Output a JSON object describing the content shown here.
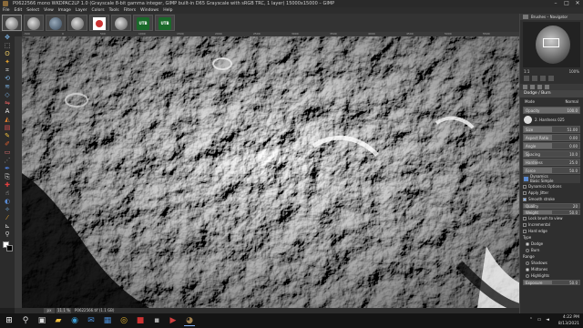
{
  "window": {
    "title": "P0622566 mono WKDPAC2LP 1.0 (Grayscale 8-bit gamma integer, GIMP built-in D65 Grayscale with sRGB TRC, 1 layer) 15000x15000 – GIMP",
    "controls": [
      "–",
      "□",
      "✕"
    ]
  },
  "menu": [
    "File",
    "Edit",
    "Select",
    "View",
    "Image",
    "Layer",
    "Colors",
    "Tools",
    "Filters",
    "Windows",
    "Help"
  ],
  "image_tabs": [
    {
      "icon": "gray-moon-thumb"
    },
    {
      "icon": "gray-moon-thumb"
    },
    {
      "icon": "globe-thumb"
    },
    {
      "icon": "gray-moon-thumb"
    },
    {
      "icon": "red-dot-thumb"
    },
    {
      "icon": "gray-moon-thumb"
    },
    {
      "icon": "utb-thumb",
      "label": "UTB"
    },
    {
      "icon": "utb-thumb",
      "label": "UTB"
    }
  ],
  "toolbox": [
    "move-icon",
    "rect-select-icon",
    "lasso-icon",
    "fuzzy-select-icon",
    "crop-icon",
    "transform-icon",
    "warp-icon",
    "perspective-icon",
    "flip-icon",
    "text-icon",
    "bucket-fill-icon",
    "gradient-icon",
    "pencil-icon",
    "paintbrush-icon",
    "eraser-icon",
    "airbrush-icon",
    "ink-icon",
    "clone-icon",
    "heal-icon",
    "smudge-icon",
    "dodge-icon",
    "path-icon",
    "color-picker-icon",
    "measure-icon",
    "zoom-icon",
    "foreground-color-icon",
    "background-color-icon"
  ],
  "rulers": {
    "h_ticks": [
      "-500",
      "0",
      "500",
      "1000",
      "1500",
      "2000",
      "2500",
      "3000",
      "3500",
      "4000",
      "4500",
      "5000",
      "5500"
    ]
  },
  "statusbar": {
    "unit": "px",
    "zoom": "11.1 %",
    "filename": "P0622566.tif (1.1 GB)"
  },
  "dock": {
    "panel_title": "Brushes – Navigator",
    "zoom_left": "1:1",
    "zoom_right": "100%",
    "tool_title": "Dodge / Burn",
    "options": [
      {
        "label": "Mode",
        "value": "Normal",
        "type": "select"
      },
      {
        "label": "Opacity",
        "value": "100.0",
        "fill": 1.0,
        "type": "bar"
      },
      {
        "label": "Brush",
        "value": "2. Hardness 025",
        "type": "brush"
      },
      {
        "label": "Size",
        "value": "51.00",
        "fill": 0.5,
        "type": "bar"
      },
      {
        "label": "Aspect Ratio",
        "value": "0.00",
        "fill": 0.5,
        "type": "bar"
      },
      {
        "label": "Angle",
        "value": "0.00",
        "fill": 0.5,
        "type": "bar"
      },
      {
        "label": "Spacing",
        "value": "10.0",
        "fill": 0.1,
        "type": "bar"
      },
      {
        "label": "Hardness",
        "value": "25.0",
        "fill": 0.25,
        "type": "bar"
      },
      {
        "label": "Force",
        "value": "50.0",
        "fill": 0.5,
        "type": "bar"
      }
    ],
    "dynamics_label": "Dynamics",
    "dynamics_value": "Basic Simple",
    "checks": [
      {
        "label": "Dynamics Options",
        "on": false
      },
      {
        "label": "Apply Jitter",
        "on": false
      },
      {
        "label": "Smooth stroke",
        "on": true
      }
    ],
    "smooth_opts": [
      {
        "label": "Quality",
        "value": "20",
        "fill": 0.2
      },
      {
        "label": "Weight",
        "value": "50.0",
        "fill": 0.5
      }
    ],
    "more_checks": [
      {
        "label": "Lock brush to view",
        "on": false
      },
      {
        "label": "Incremental",
        "on": false
      },
      {
        "label": "Hard edge",
        "on": false
      }
    ],
    "type_label": "Type",
    "type_options": [
      {
        "label": "Dodge",
        "on": true
      },
      {
        "label": "Burn",
        "on": false
      }
    ],
    "range_label": "Range",
    "range_options": [
      {
        "label": "Shadows",
        "on": false
      },
      {
        "label": "Midtones",
        "on": true
      },
      {
        "label": "Highlights",
        "on": false
      }
    ],
    "exposure_label": "Exposure",
    "exposure_value": "50.0",
    "exposure_fill": 0.5
  },
  "taskbar": {
    "items": [
      "windows-start-icon",
      "search-icon",
      "task-view-icon",
      "file-explorer-icon",
      "edge-icon",
      "mail-icon",
      "store-icon",
      "chrome-icon",
      "app-icon",
      "app-icon",
      "media-icon",
      "gimp-icon"
    ],
    "tray_icons": [
      "chevron-up-icon",
      "network-icon",
      "volume-icon"
    ],
    "time": "4:22 PM",
    "date": "8/13/2021"
  },
  "colors": {
    "accent": "#8ab4f8",
    "background": "#2f2f2f"
  }
}
